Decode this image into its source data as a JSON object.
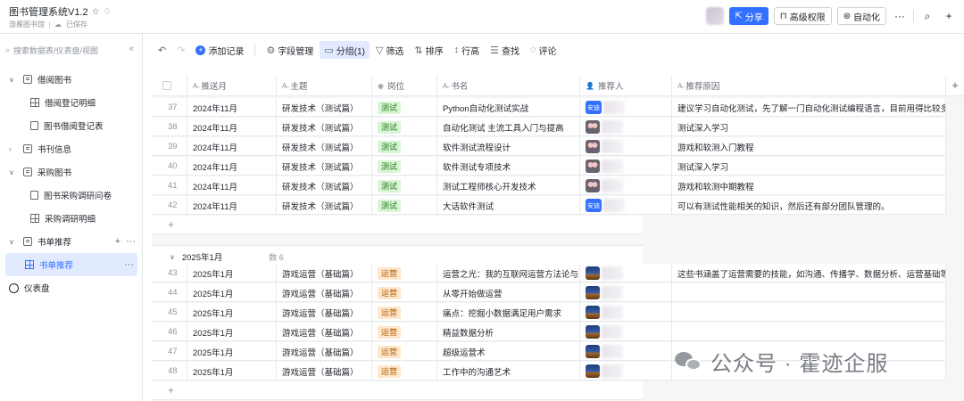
{
  "header": {
    "title": "图书管理系统V1.2",
    "subtitle_workspace": "游雁图书馆",
    "saved_status": "已保存",
    "share_label": "分享",
    "permission_label": "高级权限",
    "automation_label": "自动化"
  },
  "sidebar": {
    "search_placeholder": "搜索数据表/仪表盘/视图",
    "items": [
      {
        "label": "借阅图书"
      },
      {
        "label": "借阅登记明细"
      },
      {
        "label": "图书借阅登记表"
      },
      {
        "label": "书刊信息"
      },
      {
        "label": "采购图书"
      },
      {
        "label": "图书采购调研问卷"
      },
      {
        "label": "采购调研明细"
      },
      {
        "label": "书单推荐"
      },
      {
        "label": "书单推荐"
      },
      {
        "label": "仪表盘"
      }
    ]
  },
  "toolbar": {
    "add_record": "添加记录",
    "field_manage": "字段管理",
    "group": "分组(1)",
    "filter": "筛选",
    "sort": "排序",
    "row_height": "行高",
    "find": "查找",
    "comment": "评论"
  },
  "table": {
    "columns": [
      "推送月",
      "主题",
      "岗位",
      "书名",
      "推荐人",
      "推荐原因"
    ],
    "group1_rows": [
      {
        "no": "37",
        "month": "2024年11月",
        "topic": "研发技术（测试篇）",
        "role": "测试",
        "book": "Python自动化测试实战",
        "rec": "blue",
        "reason": "建议学习自动化测试，先了解一门自动化测试编程语言，目前用得比较多..."
      },
      {
        "no": "38",
        "month": "2024年11月",
        "topic": "研发技术（测试篇）",
        "role": "测试",
        "book": "自动化测试 主流工具入门与提高",
        "rec": "cartoon",
        "reason": "测试深入学习"
      },
      {
        "no": "39",
        "month": "2024年11月",
        "topic": "研发技术（测试篇）",
        "role": "测试",
        "book": "软件测试流程设计",
        "rec": "cartoon",
        "reason": "游戏和软测入门教程"
      },
      {
        "no": "40",
        "month": "2024年11月",
        "topic": "研发技术（测试篇）",
        "role": "测试",
        "book": "软件测试专项技术",
        "rec": "cartoon",
        "reason": "测试深入学习"
      },
      {
        "no": "41",
        "month": "2024年11月",
        "topic": "研发技术（测试篇）",
        "role": "测试",
        "book": "测试工程师核心开发技术",
        "rec": "cartoon",
        "reason": "游戏和软测中期教程"
      },
      {
        "no": "42",
        "month": "2024年11月",
        "topic": "研发技术（测试篇）",
        "role": "测试",
        "book": "大话软件测试",
        "rec": "blue",
        "reason": "可以有测试性能相关的知识，然后还有部分团队管理的。"
      }
    ],
    "group2_title": "2025年1月",
    "group2_count": "数 6",
    "group2_rows": [
      {
        "no": "43",
        "month": "2025年1月",
        "topic": "游戏运营（基础篇）",
        "role": "运营",
        "book": "运营之光：我的互联网运营方法论与...",
        "rec": "night",
        "reason": "这些书涵盖了运营需要的技能，如沟通、传播学、数据分析、运营基础等..."
      },
      {
        "no": "44",
        "month": "2025年1月",
        "topic": "游戏运营（基础篇）",
        "role": "运营",
        "book": "从零开始做运营",
        "rec": "night",
        "reason": ""
      },
      {
        "no": "45",
        "month": "2025年1月",
        "topic": "游戏运营（基础篇）",
        "role": "运营",
        "book": "痛点：挖掘小数据满足用户需求",
        "rec": "night",
        "reason": ""
      },
      {
        "no": "46",
        "month": "2025年1月",
        "topic": "游戏运营（基础篇）",
        "role": "运营",
        "book": "精益数据分析",
        "rec": "night",
        "reason": ""
      },
      {
        "no": "47",
        "month": "2025年1月",
        "topic": "游戏运营（基础篇）",
        "role": "运营",
        "book": "超级运营术",
        "rec": "night",
        "reason": ""
      },
      {
        "no": "48",
        "month": "2025年1月",
        "topic": "游戏运营（基础篇）",
        "role": "运营",
        "book": "工作中的沟通艺术",
        "rec": "night",
        "reason": ""
      }
    ],
    "rec_blue_text": "安迪"
  },
  "watermark": "公众号 · 霍迹企服"
}
